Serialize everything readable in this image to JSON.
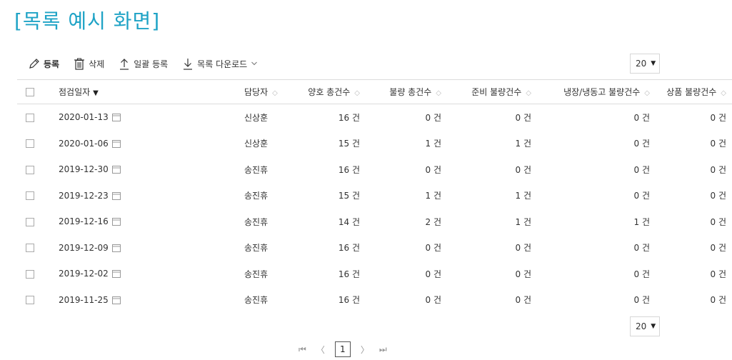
{
  "page": {
    "title": "[목록 예시 화면]"
  },
  "toolbar": {
    "register": "등록",
    "delete": "삭제",
    "bulk_register": "일괄 등록",
    "download_list": "목록 다운로드"
  },
  "page_size": {
    "value": "20"
  },
  "table": {
    "headers": {
      "date": "점검일자",
      "manager": "담당자",
      "good_total": "양호 총건수",
      "bad_total": "불량 총건수",
      "prep_bad": "준비 불량건수",
      "fridge_bad": "냉장/냉동고 불량건수",
      "goods_bad": "상품 불량건수"
    },
    "rows": [
      {
        "date": "2020-01-13",
        "manager": "신상훈",
        "good": "16 건",
        "bad": "0 건",
        "prep": "0 건",
        "fridge": "0 건",
        "goods": "0 건"
      },
      {
        "date": "2020-01-06",
        "manager": "신상훈",
        "good": "15 건",
        "bad": "1 건",
        "prep": "1 건",
        "fridge": "0 건",
        "goods": "0 건"
      },
      {
        "date": "2019-12-30",
        "manager": "송진휴",
        "good": "16 건",
        "bad": "0 건",
        "prep": "0 건",
        "fridge": "0 건",
        "goods": "0 건"
      },
      {
        "date": "2019-12-23",
        "manager": "송진휴",
        "good": "15 건",
        "bad": "1 건",
        "prep": "1 건",
        "fridge": "0 건",
        "goods": "0 건"
      },
      {
        "date": "2019-12-16",
        "manager": "송진휴",
        "good": "14 건",
        "bad": "2 건",
        "prep": "1 건",
        "fridge": "1 건",
        "goods": "0 건"
      },
      {
        "date": "2019-12-09",
        "manager": "송진휴",
        "good": "16 건",
        "bad": "0 건",
        "prep": "0 건",
        "fridge": "0 건",
        "goods": "0 건"
      },
      {
        "date": "2019-12-02",
        "manager": "송진휴",
        "good": "16 건",
        "bad": "0 건",
        "prep": "0 건",
        "fridge": "0 건",
        "goods": "0 건"
      },
      {
        "date": "2019-11-25",
        "manager": "송진휴",
        "good": "16 건",
        "bad": "0 건",
        "prep": "0 건",
        "fridge": "0 건",
        "goods": "0 건"
      }
    ]
  },
  "pagination": {
    "current": "1"
  },
  "icons": {
    "register": "pencil-icon",
    "delete": "trash-icon",
    "bulk_register": "upload-arrow-icon",
    "download": "download-arrow-icon",
    "calendar": "calendar-icon"
  },
  "colors": {
    "title": "#1fa3c6"
  }
}
